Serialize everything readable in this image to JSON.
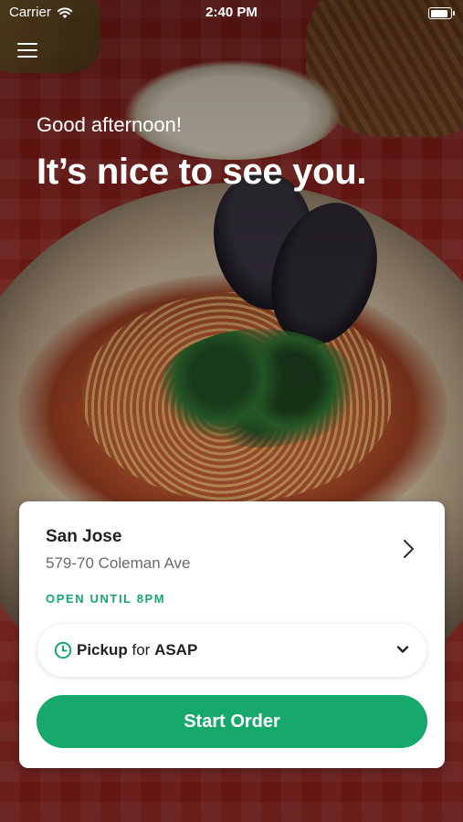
{
  "status_bar": {
    "carrier": "Carrier",
    "time": "2:40 PM",
    "battery_level": 1.0
  },
  "header": {
    "menu_icon": "hamburger-menu-icon",
    "greeting": "Good afternoon!",
    "headline": "It’s nice to see you."
  },
  "location_card": {
    "name": "San Jose",
    "address": "579-70 Coleman Ave",
    "hours": "OPEN UNTIL 8PM",
    "chevron_icon": "chevron-right-icon"
  },
  "order_type": {
    "icon": "clock-icon",
    "mode": "Pickup",
    "connector": "for",
    "time": "ASAP",
    "dropdown_icon": "chevron-down-icon"
  },
  "actions": {
    "start_order": "Start Order"
  },
  "colors": {
    "accent_green": "#17a86b",
    "card_bg": "#ffffff"
  }
}
